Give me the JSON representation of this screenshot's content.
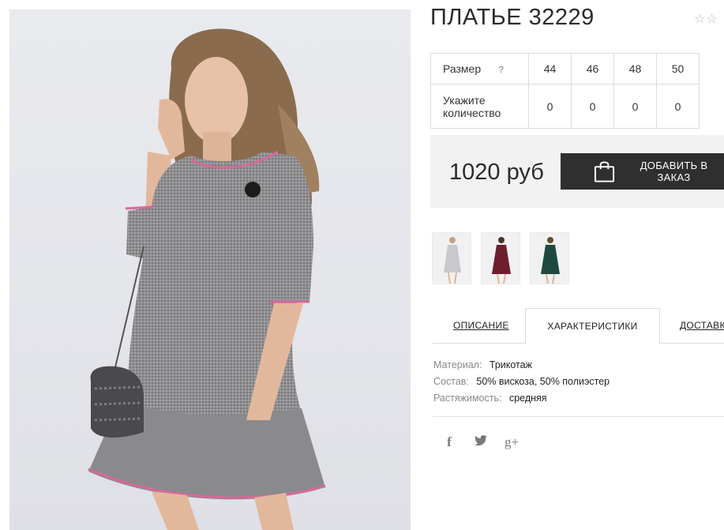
{
  "product": {
    "title": "ПЛАТЬЕ 32229",
    "rating_stars": "☆☆"
  },
  "size_table": {
    "size_label": "Размер",
    "help": "?",
    "sizes": [
      "44",
      "46",
      "48",
      "50"
    ],
    "qty_label": "Укажите количество",
    "quantities": [
      "0",
      "0",
      "0",
      "0"
    ]
  },
  "purchase": {
    "price": "1020 руб",
    "add_button": "ДОБАВИТЬ В ЗАКАЗ",
    "icon": "shopping-bag-icon"
  },
  "thumbnails": [
    {
      "color": "#c9c9cb",
      "label": "grey"
    },
    {
      "color": "#6e1f2e",
      "label": "burgundy"
    },
    {
      "color": "#1e4a3e",
      "label": "green"
    }
  ],
  "tabs": {
    "description": "ОПИСАНИЕ",
    "characteristics": "ХАРАКТЕРИСТИКИ",
    "delivery": "ДОСТАВК"
  },
  "specs": [
    {
      "key": "Материал:",
      "value": "Трикотаж"
    },
    {
      "key": "Состав:",
      "value": "50% вискоза, 50% полиэстер"
    },
    {
      "key": "Растяжимость:",
      "value": "средняя"
    }
  ],
  "social": {
    "facebook": "f",
    "twitter": "🐦",
    "google_plus": "g+"
  },
  "colors": {
    "button_bg": "#2f2f2f",
    "price_box_bg": "#f2f2f2",
    "dress": "#8d8d8f",
    "trim": "#d9689a"
  }
}
